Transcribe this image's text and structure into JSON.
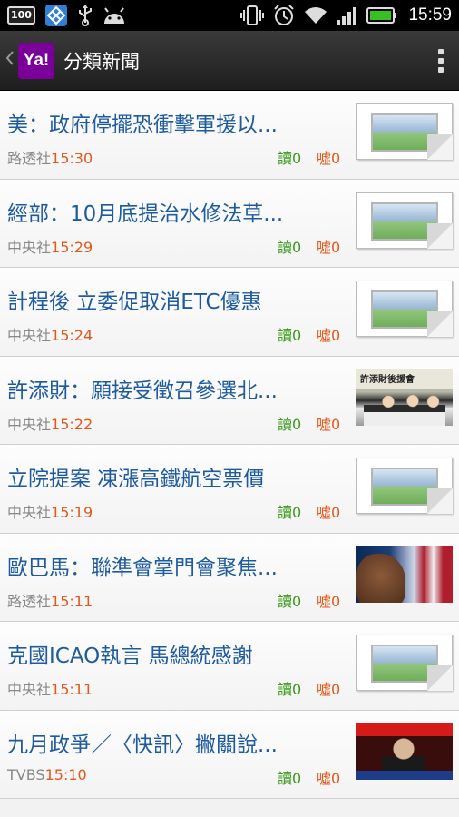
{
  "status_bar": {
    "badge": "100",
    "time": "15:59"
  },
  "action_bar": {
    "logo_text": "Ya!",
    "title": "分類新聞"
  },
  "labels": {
    "read": "讀",
    "boo": "噓"
  },
  "news": [
    {
      "headline": "美：政府停擺恐衝擊軍援以...",
      "source": "路透社",
      "time": "15:30",
      "read": "讀0",
      "boo": "噓0",
      "thumbnail": "placeholder-image"
    },
    {
      "headline": "經部：10月底提治水修法草...",
      "source": "中央社",
      "time": "15:29",
      "read": "讀0",
      "boo": "噓0",
      "thumbnail": "placeholder-image"
    },
    {
      "headline": "計程後 立委促取消ETC優惠",
      "source": "中央社",
      "time": "15:24",
      "read": "讀0",
      "boo": "噓0",
      "thumbnail": "placeholder-image"
    },
    {
      "headline": "許添財：願接受徵召參選北...",
      "source": "中央社",
      "time": "15:22",
      "read": "讀0",
      "boo": "噓0",
      "thumbnail": "photo-meeting",
      "photo_caption": "許添財後援會"
    },
    {
      "headline": "立院提案 凍漲高鐵航空票價",
      "source": "中央社",
      "time": "15:19",
      "read": "讀0",
      "boo": "噓0",
      "thumbnail": "placeholder-image"
    },
    {
      "headline": "歐巴馬：聯準會掌門會聚焦...",
      "source": "路透社",
      "time": "15:11",
      "read": "讀0",
      "boo": "噓0",
      "thumbnail": "photo-portrait"
    },
    {
      "headline": "克國ICAO執言 馬總統感謝",
      "source": "中央社",
      "time": "15:11",
      "read": "讀0",
      "boo": "噓0",
      "thumbnail": "placeholder-image"
    },
    {
      "headline": "九月政爭／〈快訊〉撇關說...",
      "source": "TVBS",
      "time": "15:10",
      "read": "讀0",
      "boo": "噓0",
      "thumbnail": "photo-tv"
    }
  ]
}
